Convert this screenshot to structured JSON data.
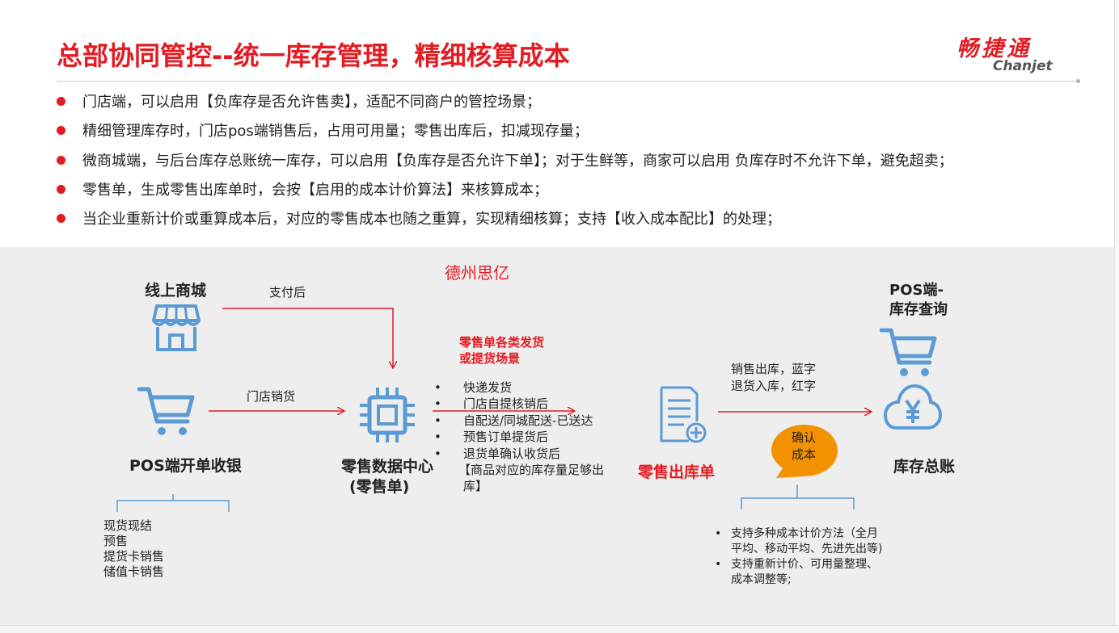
{
  "header": {
    "title": "总部协同管控--统一库存管理，精细核算成本",
    "logo_cn": "畅捷通",
    "logo_en": "Chanjet"
  },
  "bullets": [
    "门店端，可以启用【负库存是否允许售卖】，适配不同商户的管控场景；",
    "精细管理库存时，门店pos端销售后，占用可用量；零售出库后，扣减现存量；",
    "微商城端，与后台库存总账统一库存，可以启用【负库存是否允许下单】；对于生鲜等，商家可以启用 负库存时不允许下单，避免超卖；",
    "零售单，生成零售出库单时，会按【启用的成本计价算法】来核算成本；",
    "当企业重新计价或重算成本后，对应的零售成本也随之重算，实现精细核算；支持【收入成本配比】的处理；"
  ],
  "diagram": {
    "company": "德州思亿",
    "online_store": "线上商城",
    "after_payment": "支付后",
    "store_sales": "门店销货",
    "pos_cashier": "POS端开单收银",
    "pos_sales_types": [
      "现货现结",
      "预售",
      "提货卡销售",
      "储值卡销售"
    ],
    "retail_center_line1": "零售数据中心",
    "retail_center_line2": "(零售单)",
    "scenarios_title_line1": "零售单各类发货",
    "scenarios_title_line2": "或提货场景",
    "scenarios": [
      "快递发货",
      "门店自提核销后",
      "自配送/同城配送-已送达",
      "预售订单提货后",
      "退货单确认收货后"
    ],
    "scenario_note_line1": "【商品对应的库存量足够出",
    "scenario_note_line2": "库】",
    "retail_outbound": "零售出库单",
    "sales_outbound": "销售出库，蓝字",
    "return_inbound": "退货入库，红字",
    "confirm_cost_line1": "确认",
    "confirm_cost_line2": "成本",
    "pos_query_line1": "POS端-",
    "pos_query_line2": "库存查询",
    "inventory_ledger": "库存总账",
    "cost_features": [
      {
        "line1": "支持多种成本计价方法（全月",
        "line2": "平均、移动平均、先进先出等)"
      },
      {
        "line1": "支持重新计价、可用量整理、",
        "line2": "成本调整等;"
      }
    ]
  },
  "colors": {
    "brand_red": "#e31b23",
    "icon_blue": "#5b9bd5",
    "bubble_orange": "#f39200",
    "panel_gray": "#eeeeee"
  },
  "icons": [
    "store-icon",
    "cart-icon",
    "chip-icon",
    "document-plus-icon",
    "cart-query-icon",
    "yen-cloud-icon"
  ]
}
